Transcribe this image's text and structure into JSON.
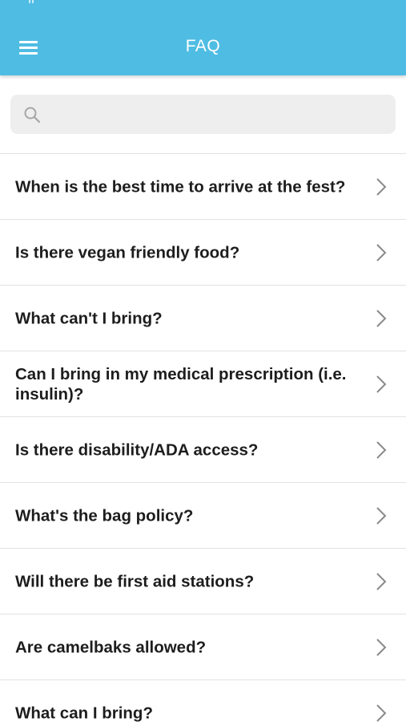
{
  "header": {
    "title": "FAQ",
    "color": "#4fbde3",
    "menu_icon": "hamburger-menu-icon"
  },
  "search": {
    "icon": "search-icon",
    "placeholder": "",
    "value": ""
  },
  "faq": {
    "items": [
      {
        "question": "When is the best time to arrive at the fest?"
      },
      {
        "question": "Is there vegan friendly food?"
      },
      {
        "question": "What can't I bring?"
      },
      {
        "question": "Can I bring in my medical prescription (i.e. insulin)?"
      },
      {
        "question": "Is there disability/ADA access?"
      },
      {
        "question": "What's the bag policy?"
      },
      {
        "question": "Will there be first aid stations?"
      },
      {
        "question": "Are camelbaks allowed?"
      },
      {
        "question": "What can I bring?"
      }
    ]
  }
}
